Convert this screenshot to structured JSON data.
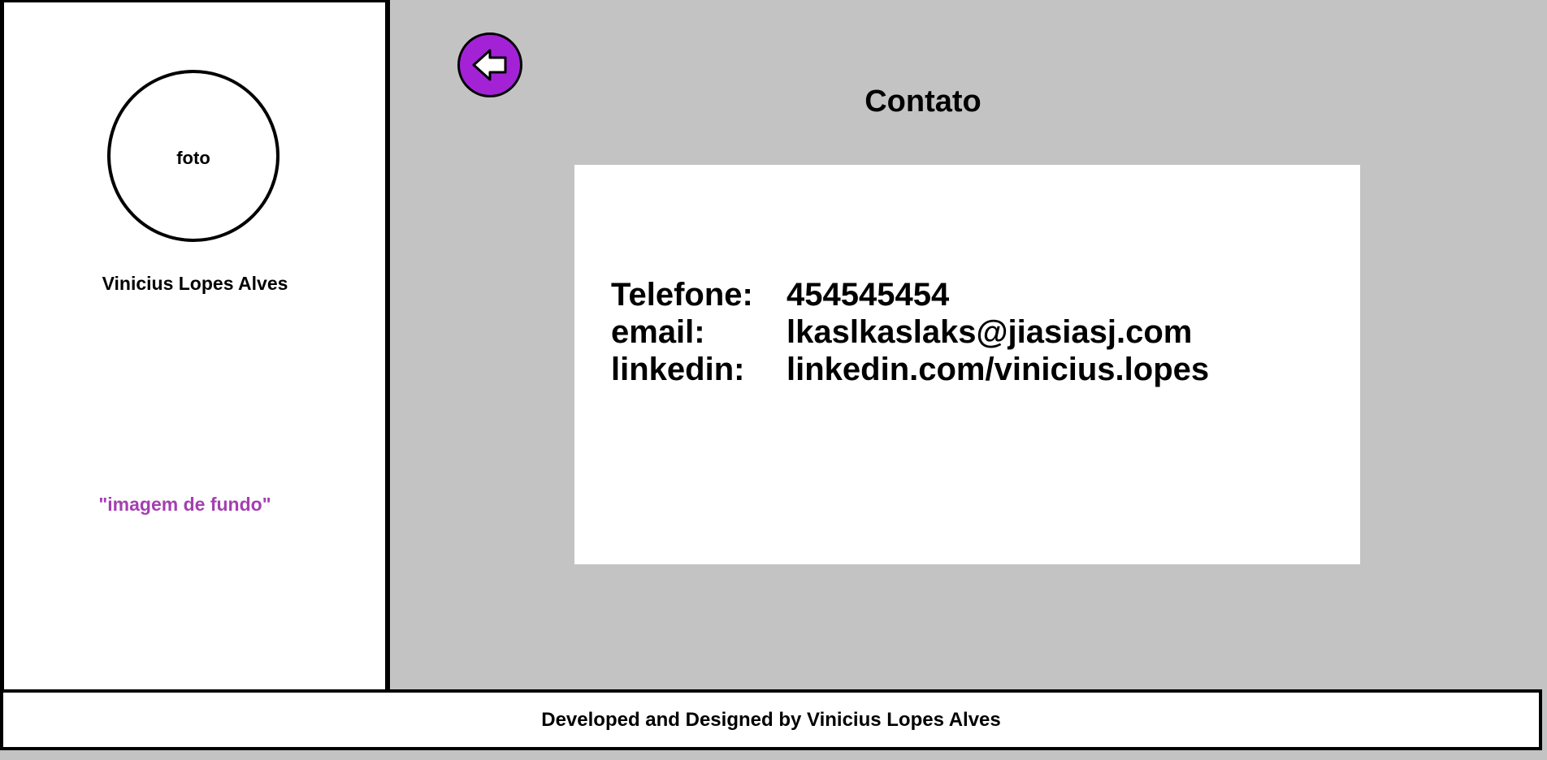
{
  "sidebar": {
    "photo_label": "foto",
    "name": "Vinicius Lopes Alves",
    "background_note": "\"imagem de fundo\""
  },
  "header": {
    "back_icon": "arrow-left-icon",
    "title": "Contato"
  },
  "contact": {
    "rows": [
      {
        "label": "Telefone:",
        "value": "454545454"
      },
      {
        "label": "email:",
        "value": "lkaslkaslaks@jiasiasj.com"
      },
      {
        "label": "linkedin:",
        "value": "linkedin.com/vinicius.lopes"
      }
    ]
  },
  "footer": {
    "text": "Developed and Designed by Vinicius Lopes Alves"
  },
  "colors": {
    "page_background": "#c3c3c3",
    "panel_background": "#ffffff",
    "accent_purple": "#a322d6",
    "note_purple": "#a43fb0",
    "border": "#000000"
  }
}
